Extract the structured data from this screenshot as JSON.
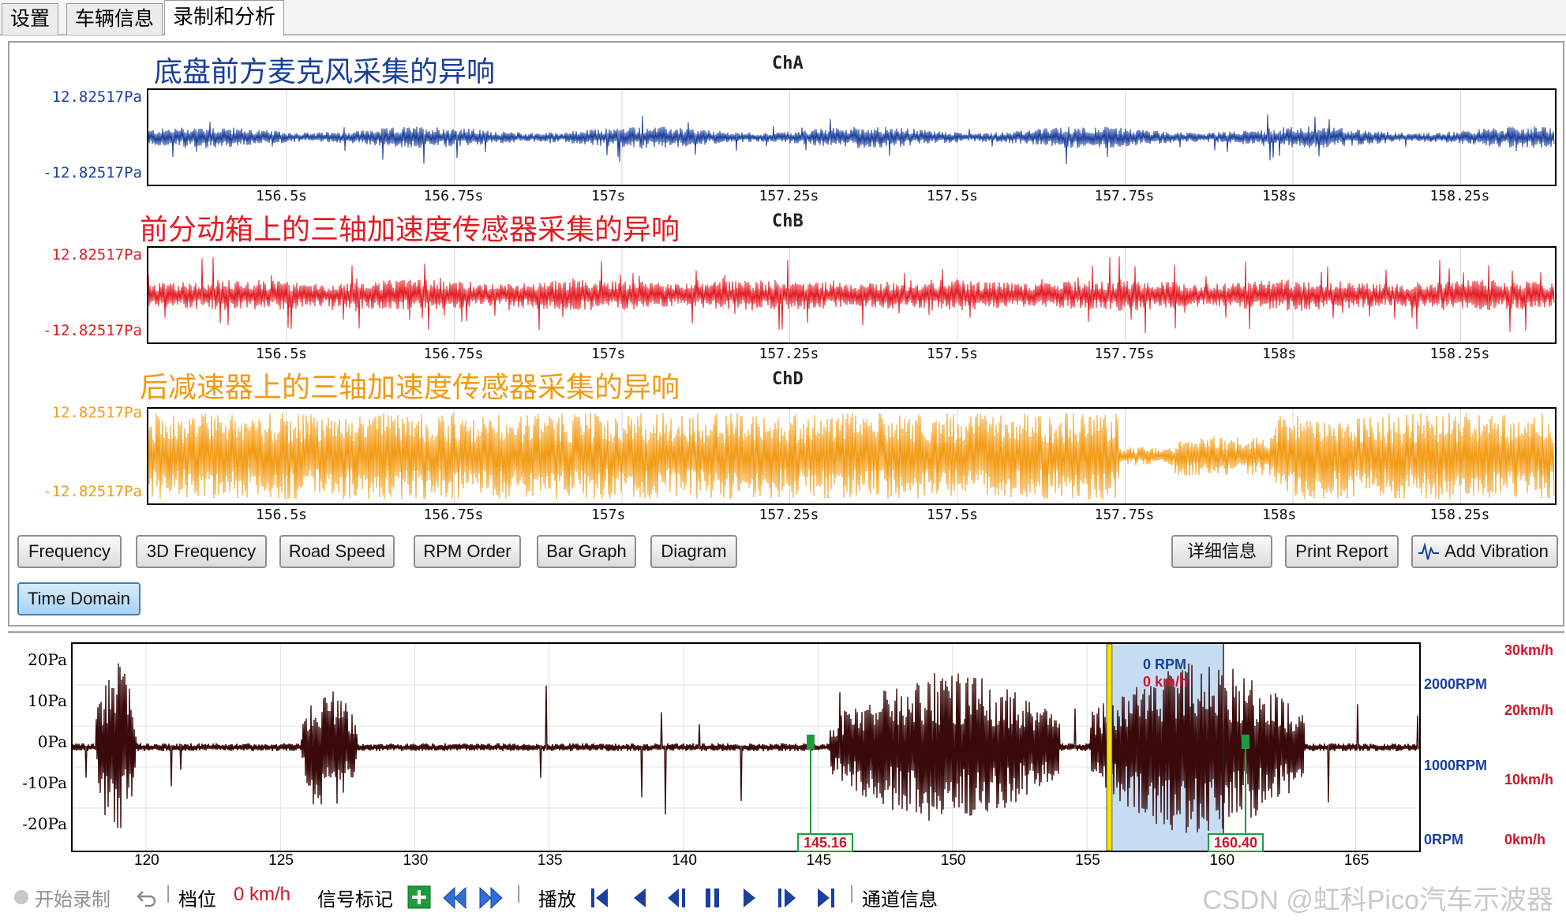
{
  "tabs": [
    {
      "label": "设置"
    },
    {
      "label": "车辆信息"
    },
    {
      "label": "录制和分析"
    }
  ],
  "channels": [
    {
      "title": "底盘前方麦克风采集的异响",
      "id": "ChA",
      "ymax": "12.82517Pa",
      "ymin": "-12.82517Pa",
      "color": "#1a3f9c"
    },
    {
      "title": "前分动箱上的三轴加速度传感器采集的异响",
      "id": "ChB",
      "ymax": "12.82517Pa",
      "ymin": "-12.82517Pa",
      "color": "#e31b23"
    },
    {
      "title": "后减速器上的三轴加速度传感器采集的异响",
      "id": "ChD",
      "ymax": "12.82517Pa",
      "ymin": "-12.82517Pa",
      "color": "#f39a12"
    }
  ],
  "xticks": [
    "156.5s",
    "156.75s",
    "157s",
    "157.25s",
    "157.5s",
    "157.75s",
    "158s",
    "158.25s"
  ],
  "buttons": {
    "frequency": "Frequency",
    "freq3d": "3D Frequency",
    "road_speed": "Road Speed",
    "rpm_order": "RPM Order",
    "bar_graph": "Bar Graph",
    "diagram": "Diagram",
    "details": "详细信息",
    "print_report": "Print Report",
    "add_vibration": "Add Vibration",
    "time_domain": "Time Domain"
  },
  "overview": {
    "ylabels": [
      "20Pa",
      "10Pa",
      "0Pa",
      "-10Pa",
      "-20Pa"
    ],
    "xlabels": [
      "120",
      "125",
      "130",
      "135",
      "140",
      "145",
      "150",
      "155",
      "160",
      "165"
    ],
    "rpm_labels": [
      "2000RPM",
      "1000RPM",
      "0RPM"
    ],
    "speed_labels": [
      "30km/h",
      "20km/h",
      "10km/h",
      "0km/h"
    ],
    "cursor_rpm": "0 RPM",
    "cursor_speed": "0 km/h",
    "markers": [
      "145.16",
      "160.40"
    ],
    "colors": {
      "signal": "#3a0a0a",
      "rpm": "#1a3f9c",
      "speed": "#d0142b",
      "marker": "#1b9e3a",
      "selection": "#c6dcf2",
      "cursor": "#f2e400"
    }
  },
  "toolbar": {
    "start_record": "开始录制",
    "gear": "档位",
    "speed": "0 km/h",
    "signal_mark": "信号标记",
    "play": "播放",
    "channel_info": "通道信息"
  },
  "watermark": "CSDN @虹科Pico汽车示波器"
}
